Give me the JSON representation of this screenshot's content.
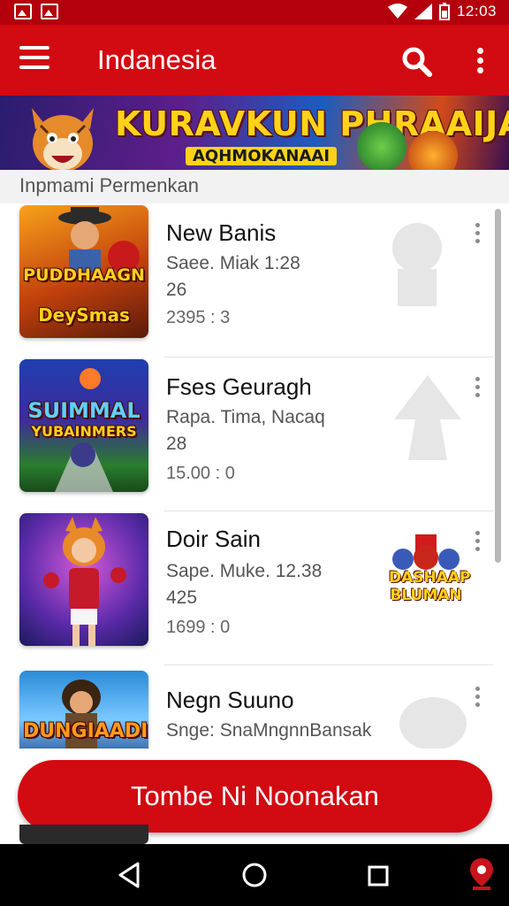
{
  "status_bar": {
    "time": "12:03",
    "icons": [
      "image-icon",
      "gallery-icon",
      "wifi-icon",
      "signal-icon",
      "battery-icon"
    ]
  },
  "app_bar": {
    "title": "Indanesia",
    "icons": [
      "menu-icon",
      "search-icon",
      "more-vert-icon"
    ],
    "color": "#d20a11"
  },
  "banner": {
    "headline": "KURAVKUN PHRAAIJAN!",
    "subtitle": "AQHMOKANAAI"
  },
  "section": {
    "title": "Inpmami Permenkan"
  },
  "games": [
    {
      "name": "New Banis",
      "meta": "Saee. Miak 1:28",
      "count": "26",
      "stat": "2395 : 3",
      "thumb_label_top": "PUDDHAAGN",
      "thumb_label_bottom": "DeySmas"
    },
    {
      "name": "Fses Geuragh",
      "meta": "Rapa. Tima, Nacaq",
      "count": "28",
      "stat": "15.00 : 0",
      "thumb_label_top": "SUIMMAL",
      "thumb_label_bottom": "YUBAINMERS"
    },
    {
      "name": "Doir Sain",
      "meta": "Sape. Muke. 12.38",
      "count": "425",
      "stat": "1699 : 0",
      "badge_top": "DASHAAP",
      "badge_bottom": "BLUMAN"
    },
    {
      "name": "Negn Suuno",
      "meta": "Snge: SnaMngnnBansak",
      "thumb_label_top": "DUNGIAADIS"
    }
  ],
  "cta": {
    "label": "Tombe Ni Noonakan"
  },
  "nav_bar": {
    "icons": [
      "back-icon",
      "home-icon",
      "recents-icon",
      "location-icon"
    ]
  }
}
